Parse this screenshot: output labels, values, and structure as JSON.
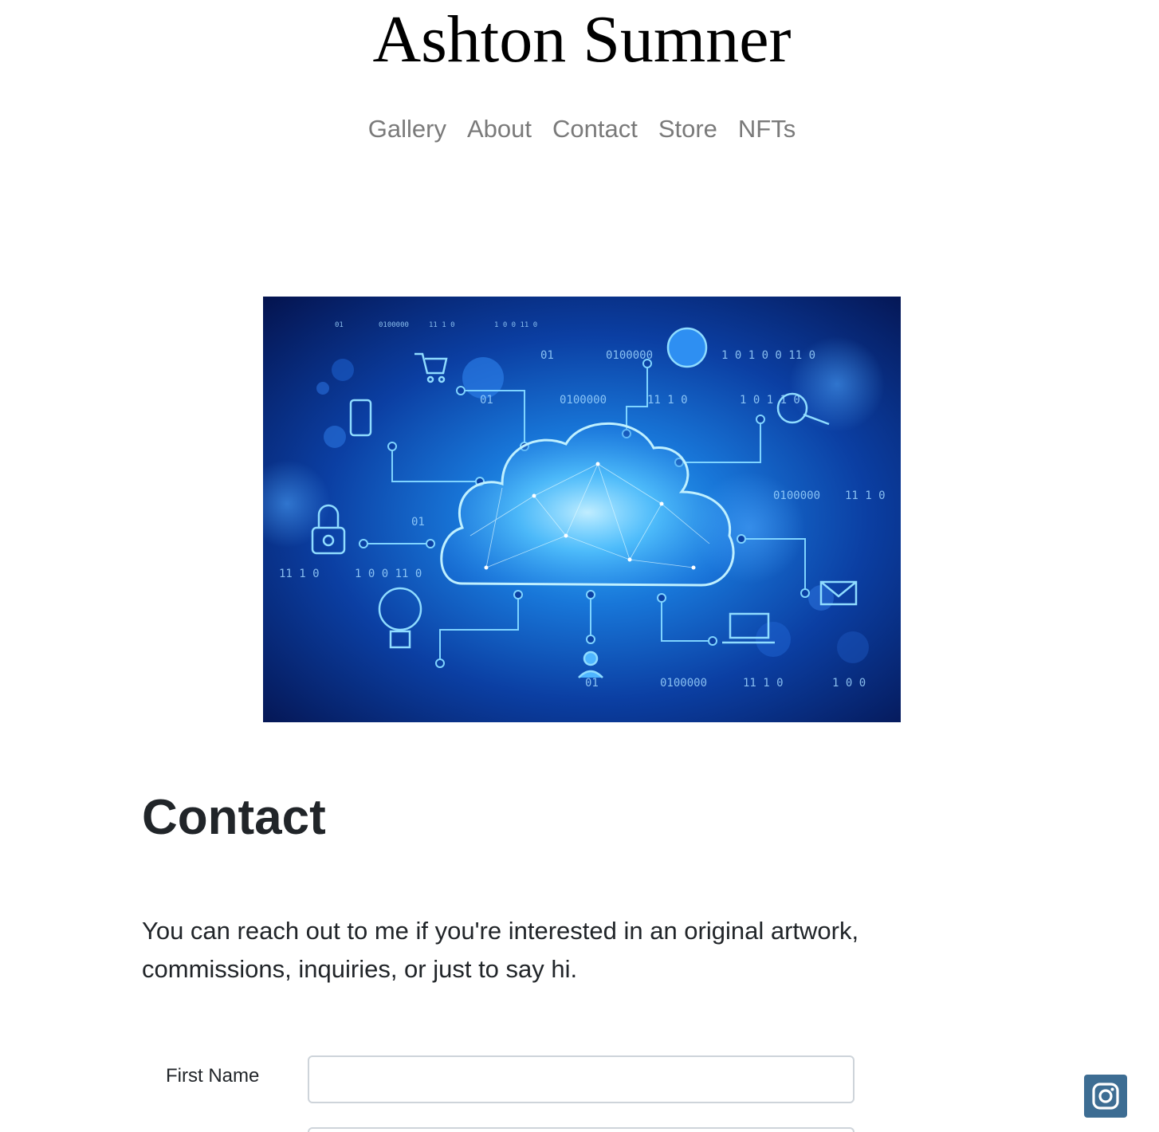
{
  "site": {
    "title": "Ashton Sumner"
  },
  "nav": {
    "items": [
      "Gallery",
      "About",
      "Contact",
      "Store",
      "NFTs"
    ]
  },
  "hero": {
    "icon": "cloud-network-illustration",
    "binary": [
      "0100000",
      "11 1 0",
      "1 0 0 11 0",
      "01",
      "0100000",
      "11 1 0",
      "1 0 0",
      "01",
      "0100000",
      "11 1 0",
      "1 0 0",
      "01",
      "0100000",
      "11 1 0",
      "1 0 0",
      "11 1 0",
      "1 0 0 11 0",
      "01",
      "0100000",
      "11 1 0",
      "1 0 0"
    ]
  },
  "contact": {
    "heading": "Contact",
    "intro": "You can reach out to me if you're interested in an original artwork, commissions, inquiries, or just to say hi."
  },
  "form": {
    "first_name_label": "First Name",
    "first_name_value": ""
  },
  "social": {
    "icon": "instagram-icon"
  },
  "colors": {
    "nav_link": "#7a7a7a",
    "text": "#212529",
    "instagram_bg": "#3d6d93",
    "input_border": "#ced4da"
  }
}
